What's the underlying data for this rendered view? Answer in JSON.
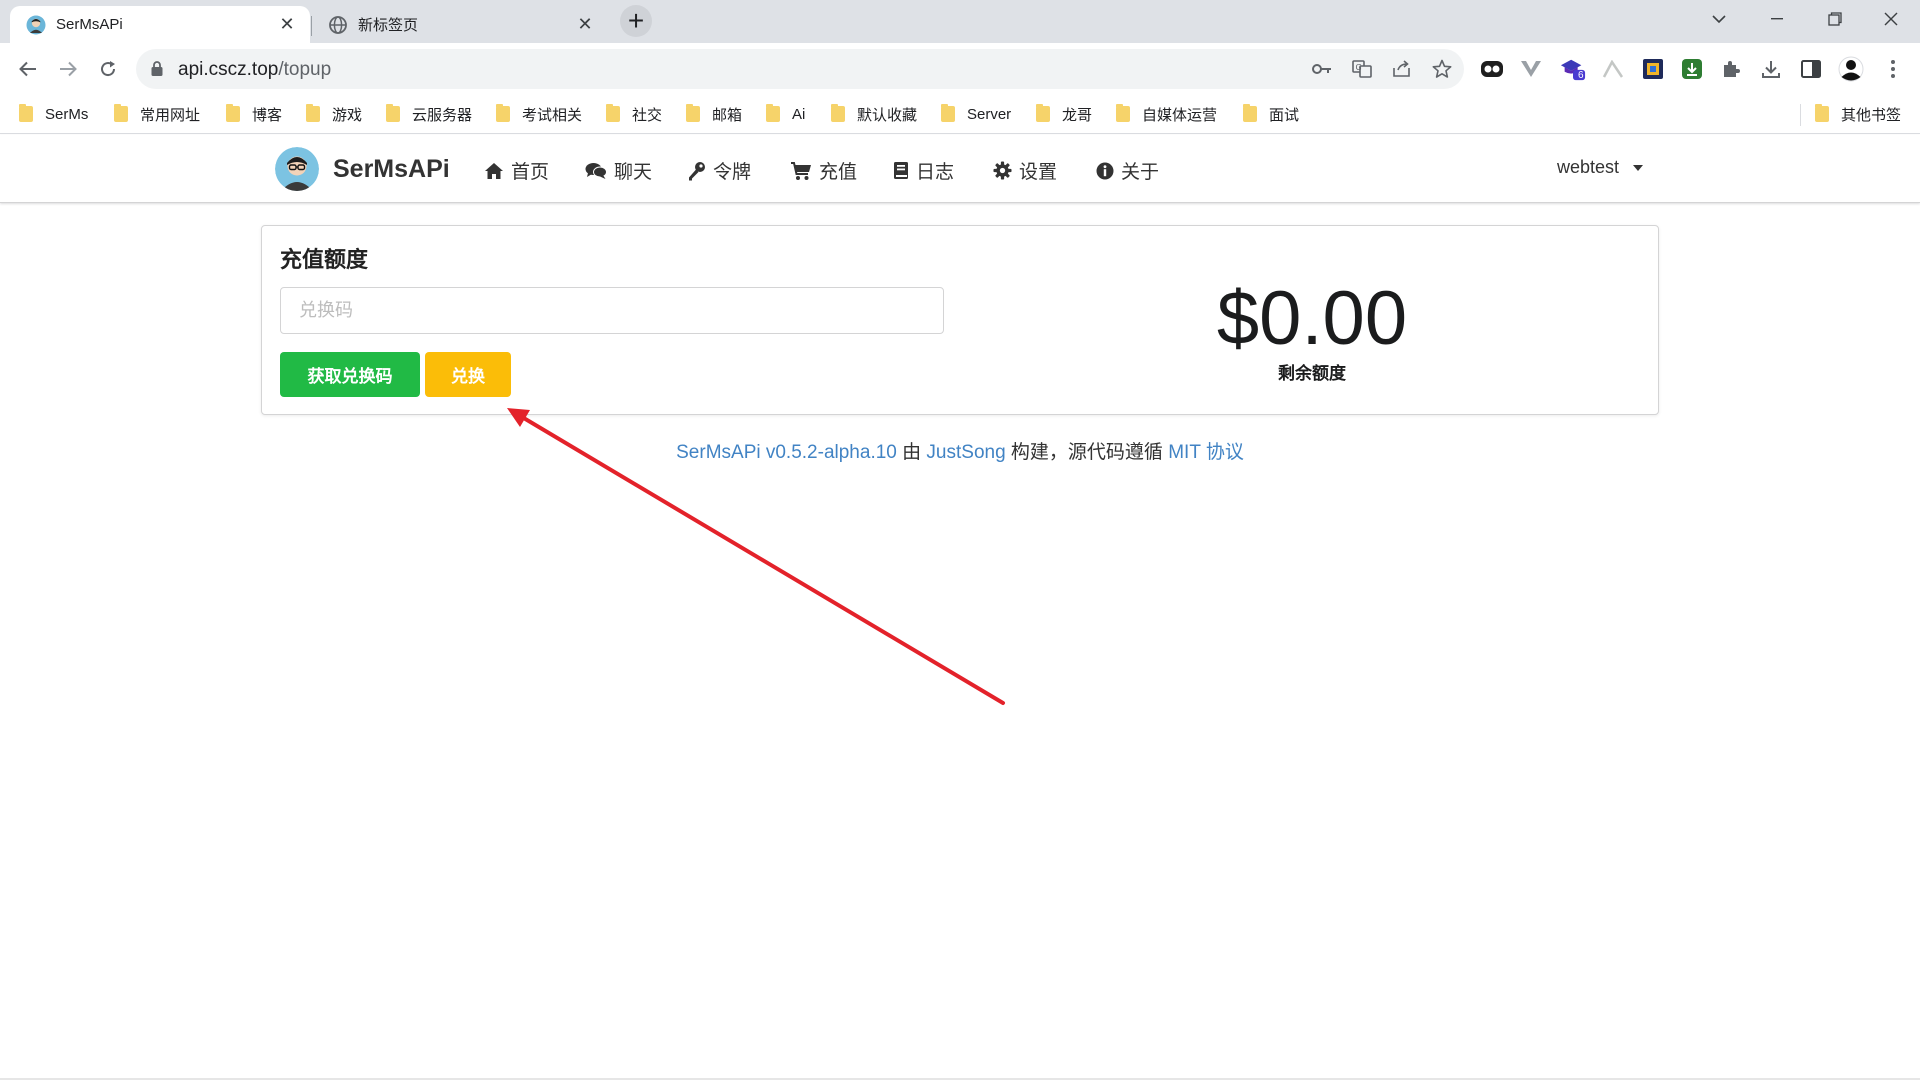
{
  "browser": {
    "tabs": [
      {
        "title": "SerMsAPi",
        "active": true
      },
      {
        "title": "新标签页",
        "active": false
      }
    ],
    "address": {
      "host": "api.cscz.top",
      "path": "/topup"
    },
    "bookmarks": [
      "SerMs",
      "常用网址",
      "博客",
      "游戏",
      "云服务器",
      "考试相关",
      "社交",
      "邮箱",
      "Ai",
      "默认收藏",
      "Server",
      "龙哥",
      "自媒体运营",
      "面试"
    ],
    "other_bookmarks": "其他书签",
    "extension_badge": "6"
  },
  "site": {
    "brand": "SerMsAPi",
    "menu": [
      {
        "label": "首页",
        "icon": "home-icon"
      },
      {
        "label": "聊天",
        "icon": "comments-icon"
      },
      {
        "label": "令牌",
        "icon": "key-icon"
      },
      {
        "label": "充值",
        "icon": "cart-icon"
      },
      {
        "label": "日志",
        "icon": "book-icon"
      },
      {
        "label": "设置",
        "icon": "gear-icon"
      },
      {
        "label": "关于",
        "icon": "info-icon"
      }
    ],
    "user": "webtest"
  },
  "topup": {
    "title": "充值额度",
    "input_placeholder": "兑换码",
    "input_value": "",
    "get_code_button": "获取兑换码",
    "redeem_button": "兑换",
    "balance": "$0.00",
    "balance_label": "剩余额度",
    "colors": {
      "green": "#21ba45",
      "yellow": "#fbbd08",
      "link": "#4183c4",
      "arrow": "#e3222a"
    }
  },
  "footer": {
    "project": "SerMsAPi v0.5.2-alpha.10",
    "by": " 由 ",
    "author": "JustSong",
    "built": " 构建，源代码遵循 ",
    "license": "MIT 协议"
  }
}
